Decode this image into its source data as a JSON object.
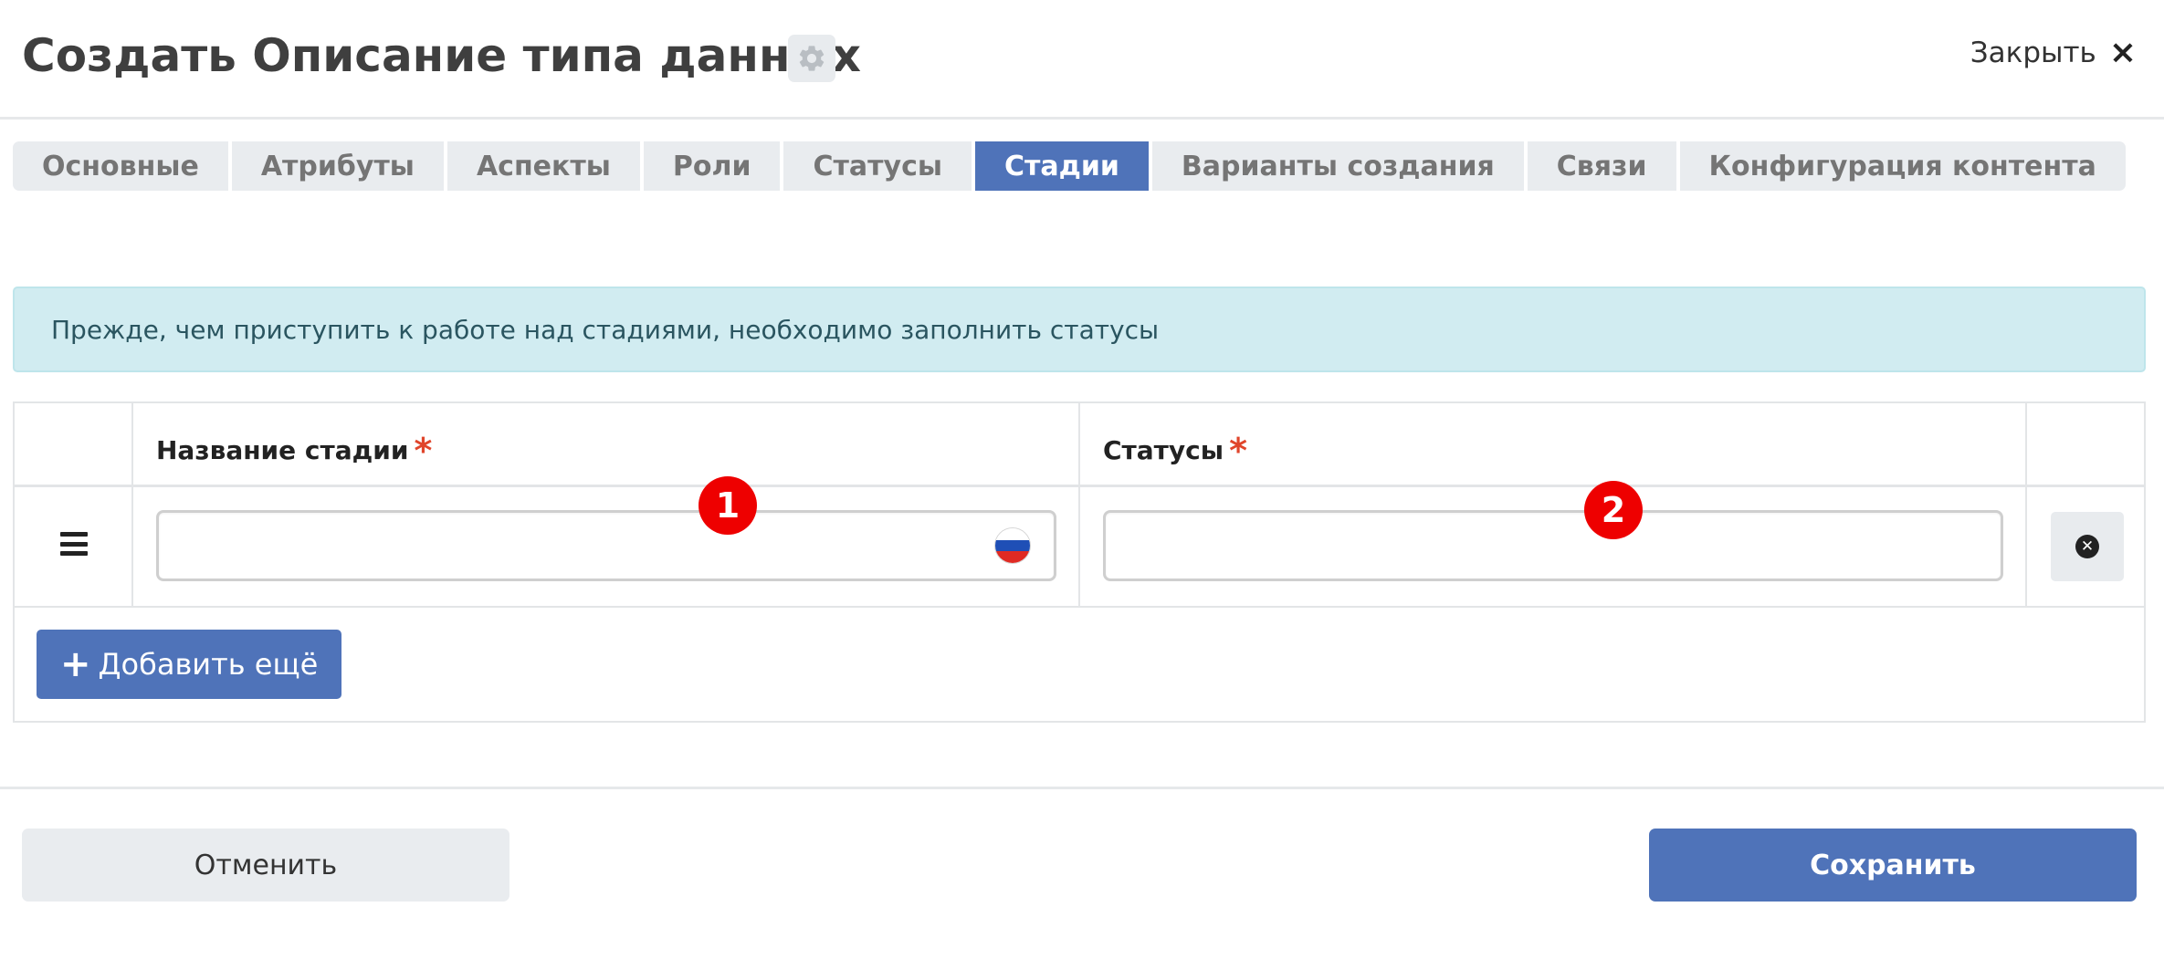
{
  "header": {
    "title": "Создать Описание типа данных",
    "settings_icon": "gear-icon",
    "close_label": "Закрыть",
    "close_icon": "×"
  },
  "tabs": [
    {
      "label": "Основные",
      "active": false
    },
    {
      "label": "Атрибуты",
      "active": false
    },
    {
      "label": "Аспекты",
      "active": false
    },
    {
      "label": "Роли",
      "active": false
    },
    {
      "label": "Статусы",
      "active": false
    },
    {
      "label": "Стадии",
      "active": true
    },
    {
      "label": "Варианты создания",
      "active": false
    },
    {
      "label": "Связи",
      "active": false
    },
    {
      "label": "Конфигурация контента",
      "active": false
    }
  ],
  "alert": {
    "text": "Прежде, чем приступить к работе над стадиями, необходимо заполнить статусы"
  },
  "table": {
    "columns": [
      {
        "label": "Название стадии",
        "required_mark": "*"
      },
      {
        "label": "Статусы",
        "required_mark": "*"
      }
    ],
    "rows": [
      {
        "stage_name": "",
        "statuses": "",
        "language_flag": "ru-flag-icon"
      }
    ],
    "add_button": {
      "icon": "+",
      "label": "Добавить ещё"
    }
  },
  "badges": [
    "1",
    "2"
  ],
  "footer": {
    "cancel_label": "Отменить",
    "save_label": "Сохранить"
  },
  "colors": {
    "accent": "#4f73b9",
    "alert_bg": "#d1ecf1",
    "required": "#e0452b",
    "badge": "#ee0000"
  }
}
